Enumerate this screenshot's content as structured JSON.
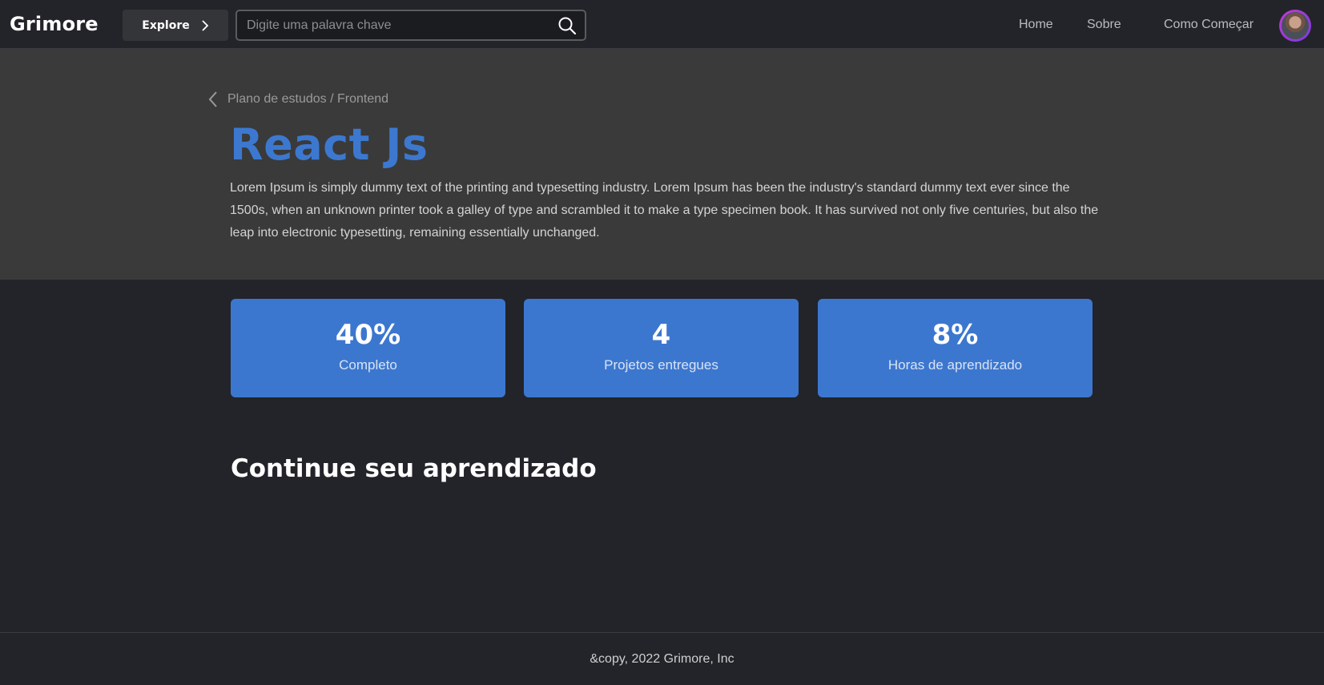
{
  "header": {
    "logo": "Grimore",
    "explore_label": "Explore",
    "search_placeholder": "Digite uma palavra chave",
    "nav": [
      {
        "label": "Home"
      },
      {
        "label": "Sobre"
      },
      {
        "label": "Como Começar"
      }
    ]
  },
  "hero": {
    "breadcrumb": "Plano de estudos / Frontend",
    "title": "React Js",
    "description": "Lorem Ipsum is simply dummy text of the printing and typesetting industry. Lorem Ipsum has been the industry's standard dummy text ever since the 1500s, when an unknown printer took a galley of type and scrambled it to make a type specimen book. It has survived not only five centuries, but also the leap into electronic typesetting, remaining essentially unchanged."
  },
  "stats": [
    {
      "value": "40%",
      "label": "Completo"
    },
    {
      "value": "4",
      "label": "Projetos entregues"
    },
    {
      "value": "8%",
      "label": "Horas de aprendizado"
    }
  ],
  "section": {
    "title": "Continue seu aprendizado"
  },
  "footer": {
    "text": "&copy, 2022 Grimore, Inc"
  },
  "colors": {
    "accent": "#3c77cf",
    "background": "#222429",
    "hero_background": "#3a3a3a"
  },
  "icons": {
    "explore": "chevron-right-icon",
    "search": "search-icon",
    "back": "chevron-left-icon"
  }
}
